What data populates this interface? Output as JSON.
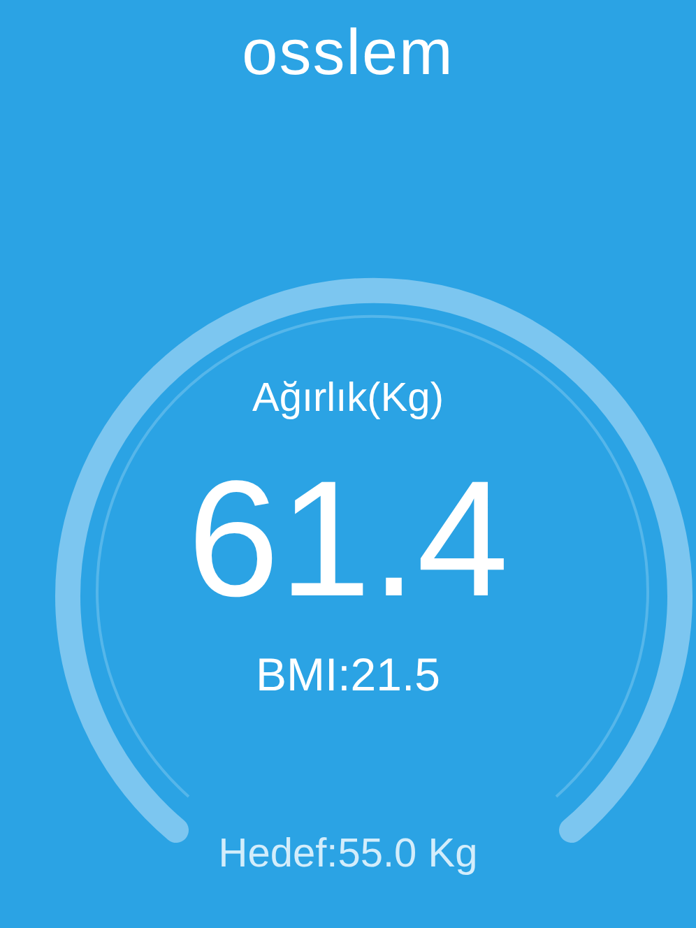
{
  "app_title": "osslem",
  "gauge": {
    "label": "Ağırlık(Kg)",
    "value": "61.4",
    "bmi": "BMI:21.5",
    "target": "Hedef:55.0 Kg"
  }
}
